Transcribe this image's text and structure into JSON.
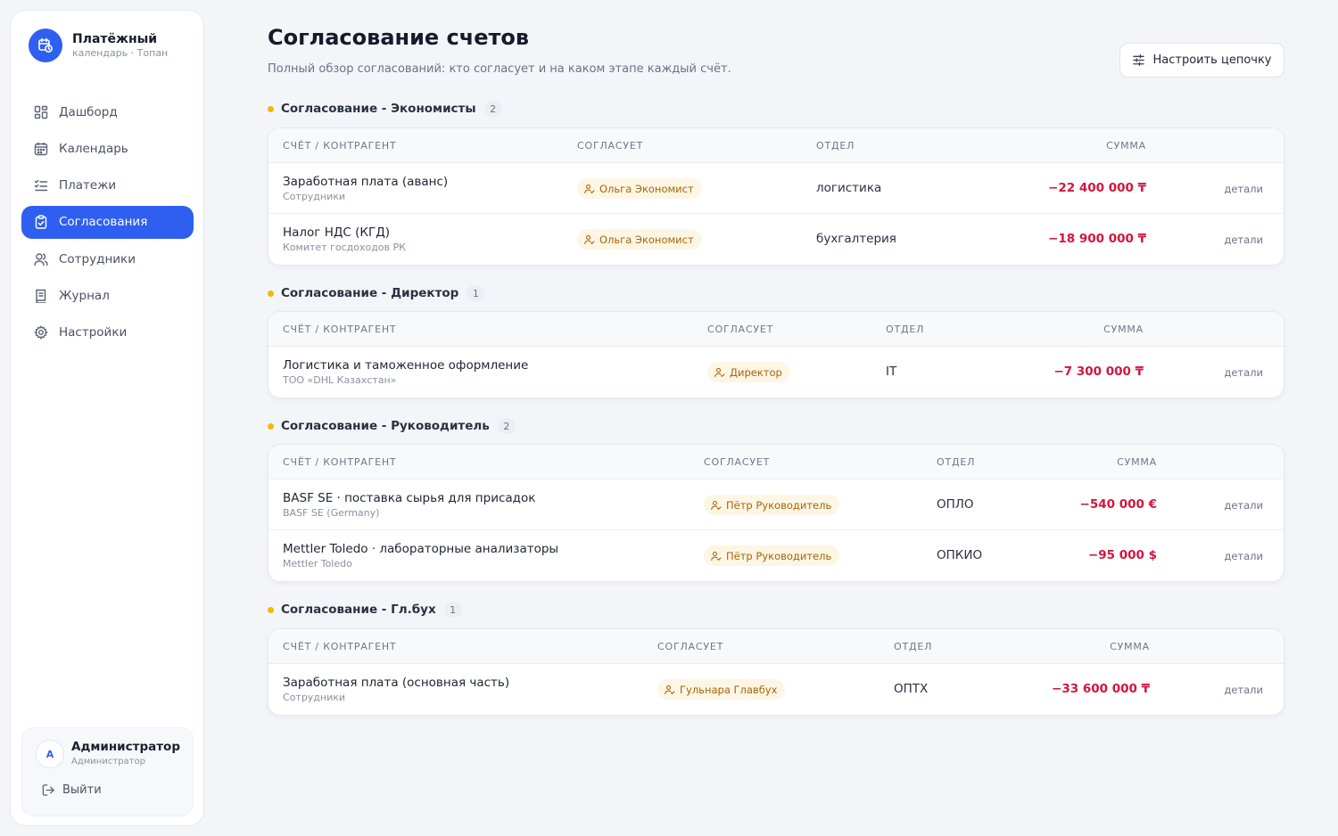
{
  "app": {
    "name": "Платёжный",
    "subtitle": "календарь · Топан"
  },
  "nav": [
    {
      "label": "Дашборд",
      "icon": "dashboard-icon",
      "active": false
    },
    {
      "label": "Календарь",
      "icon": "calendar-icon",
      "active": false
    },
    {
      "label": "Платежи",
      "icon": "list-check-icon",
      "active": false
    },
    {
      "label": "Согласования",
      "icon": "clipboard-check-icon",
      "active": true
    },
    {
      "label": "Сотрудники",
      "icon": "users-icon",
      "active": false
    },
    {
      "label": "Журнал",
      "icon": "journal-icon",
      "active": false
    },
    {
      "label": "Настройки",
      "icon": "gear-icon",
      "active": false
    }
  ],
  "user": {
    "initial": "A",
    "name": "Администратор",
    "role": "Администратор",
    "logout_label": "Выйти"
  },
  "page": {
    "title": "Согласование счетов",
    "subtitle": "Полный обзор согласований: кто согласует и на каком этапе каждый счёт.",
    "chain_button": "Настроить цепочку"
  },
  "columns": {
    "invoice": "СЧЁТ / КОНТРАГЕНТ",
    "approver": "СОГЛАСУЕТ",
    "dept": "ОТДЕЛ",
    "sum": "СУММА",
    "details_label": "детали"
  },
  "sections": [
    {
      "title": "Согласование - Экономисты",
      "count": "2",
      "rows": [
        {
          "title": "Заработная плата (аванс)",
          "party": "Сотрудники",
          "approver": "Ольга Экономист",
          "dept": "логистика",
          "amount": "−22 400 000 ₸"
        },
        {
          "title": "Налог НДС (КГД)",
          "party": "Комитет госдоходов РК",
          "approver": "Ольга Экономист",
          "dept": "бухгалтерия",
          "amount": "−18 900 000 ₸"
        }
      ]
    },
    {
      "title": "Согласование - Директор",
      "count": "1",
      "rows": [
        {
          "title": "Логистика и таможенное оформление",
          "party": "ТОО «DHL Казахстан»",
          "approver": "Директор",
          "dept": "IT",
          "amount": "−7 300 000 ₸"
        }
      ]
    },
    {
      "title": "Согласование - Руководитель",
      "count": "2",
      "rows": [
        {
          "title": "BASF SE · поставка сырья для присадок",
          "party": "BASF SE (Germany)",
          "approver": "Пётр Руководитель",
          "dept": "ОПЛО",
          "amount": "−540 000 €"
        },
        {
          "title": "Mettler Toledo · лабораторные анализаторы",
          "party": "Mettler Toledo",
          "approver": "Пётр Руководитель",
          "dept": "ОПКИО",
          "amount": "−95 000 $"
        }
      ]
    },
    {
      "title": "Согласование - Гл.бух",
      "count": "1",
      "rows": [
        {
          "title": "Заработная плата (основная часть)",
          "party": "Сотрудники",
          "approver": "Гульнара Главбух",
          "dept": "ОПТХ",
          "amount": "−33 600 000 ₸"
        }
      ]
    }
  ],
  "colors": {
    "accent": "#2f5ff0",
    "amount": "#d2163f",
    "approver_bg": "#fdf6e4",
    "approver_text": "#a8640a",
    "section_dot": "#f3b70f"
  }
}
